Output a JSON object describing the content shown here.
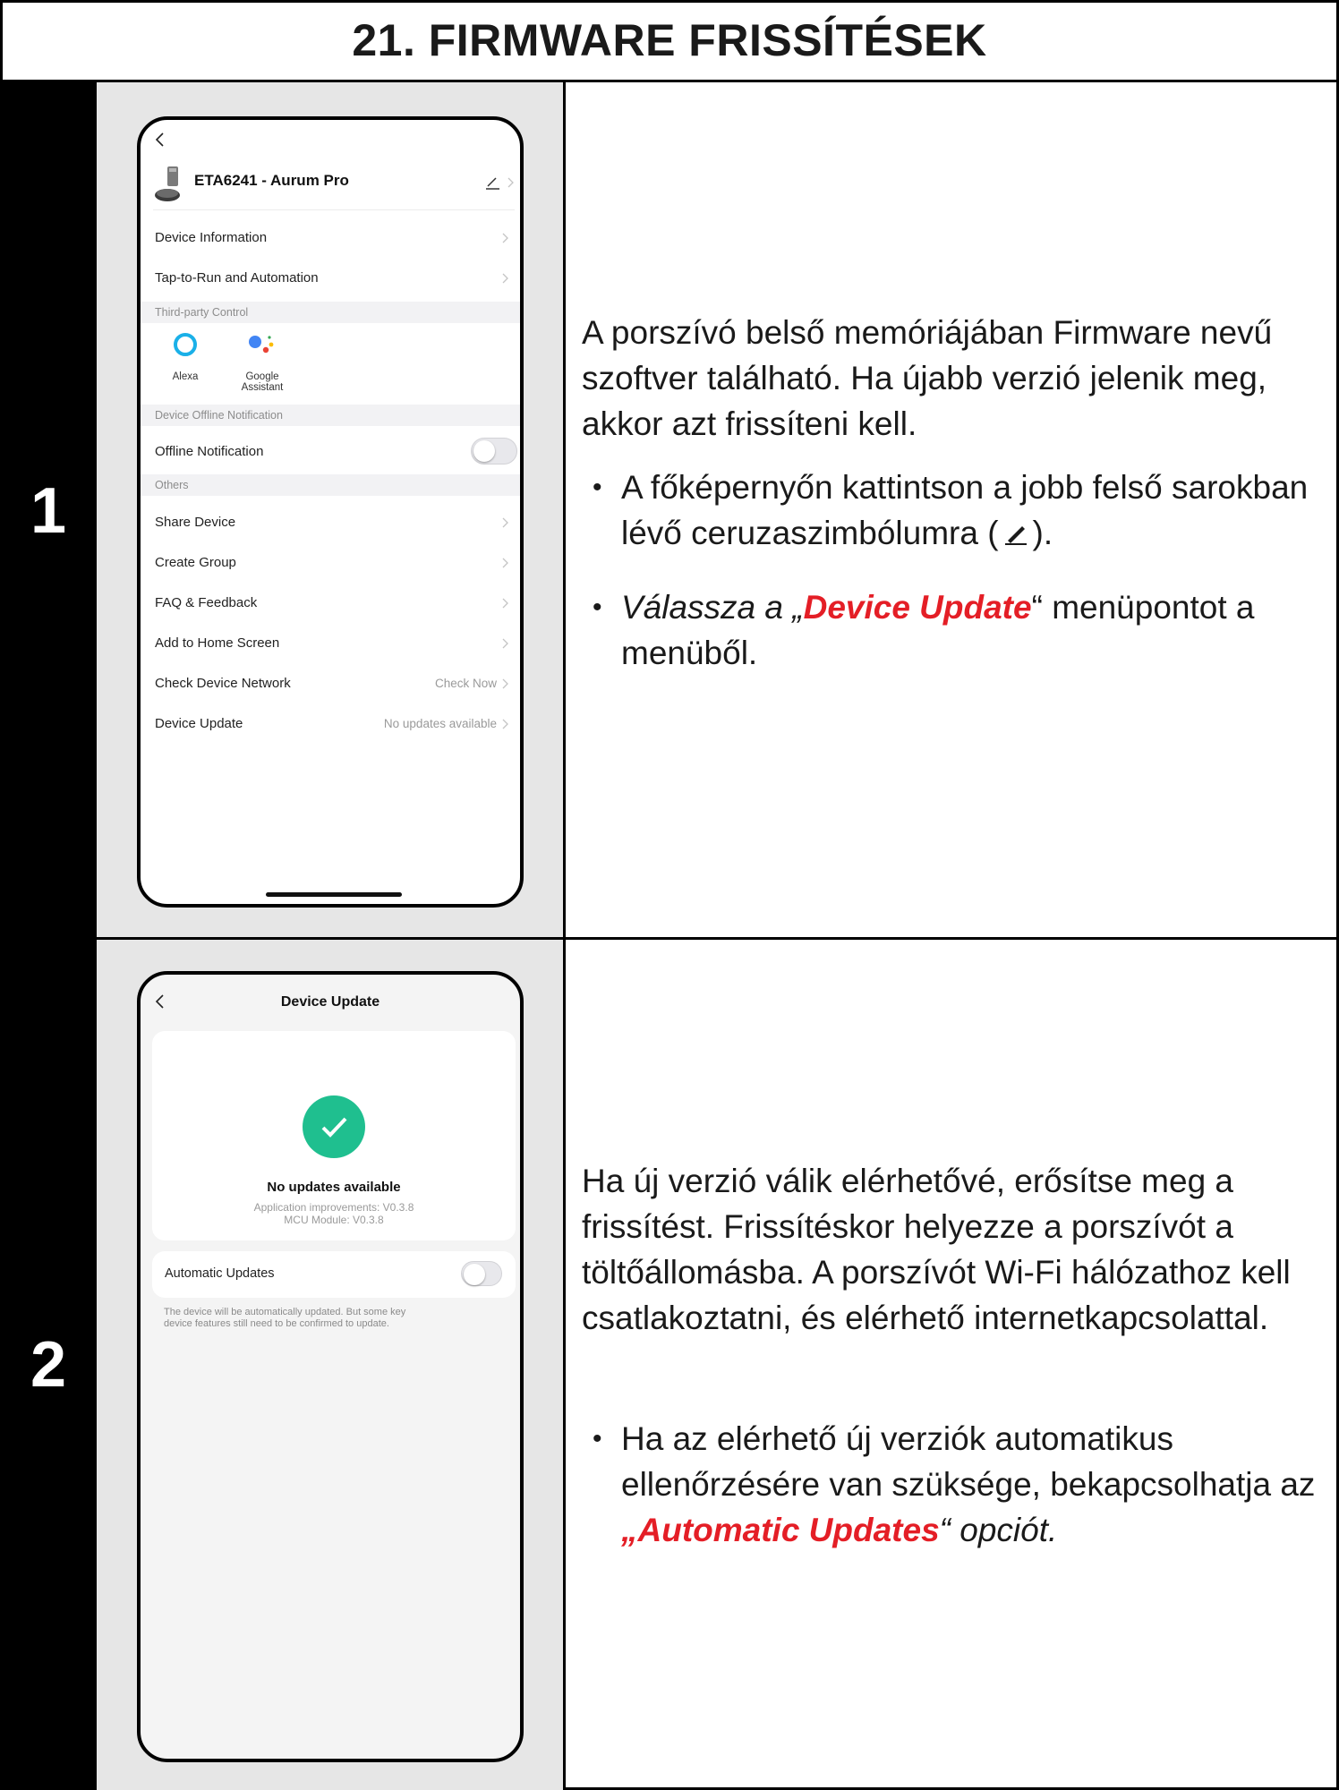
{
  "page_title": "21. FIRMWARE FRISSÍTÉSEK",
  "steps": [
    {
      "number": "1"
    },
    {
      "number": "2"
    }
  ],
  "step1": {
    "intro": "A porszívó belső memóriájában Firmware nevű szoftver található. Ha újabb verzió jelenik meg, akkor azt frissíteni kell.",
    "bullet1_text": "A főképernyőn kattintson a jobb felső sarokban lévő ceruzaszimbólumra (",
    "bullet1_end": ").",
    "bullet2_prefix": "Válassza a „",
    "bullet2_highlight": "Device Update",
    "bullet2_suffix": "“ menüpontot a menüből."
  },
  "step2": {
    "intro": "Ha új verzió válik elérhetővé, erősítse meg a frissítést. Frissítéskor helyezze a porszívót a töltőállomásba. A porszívót Wi-Fi hálózathoz kell csatlakoztatni, és elérhető internetkapcsolattal.",
    "bullet_text": "Ha az elérhető új verziók automatikus ellenőrzésére van szüksége, bekapcsolhatja az ",
    "bullet_open_quote": "„",
    "bullet_highlight": "Automatic Updates",
    "bullet_suffix": "“ opciót."
  },
  "phone1": {
    "device_name": "ETA6241 - Aurum Pro",
    "menu": {
      "device_information": "Device Information",
      "tap_to_run": "Tap-to-Run and Automation",
      "third_party_section": "Third-party Control",
      "alexa": "Alexa",
      "google_line1": "Google",
      "google_line2": "Assistant",
      "offline_section": "Device Offline Notification",
      "offline_notification": "Offline Notification",
      "others_section": "Others",
      "share_device": "Share Device",
      "create_group": "Create Group",
      "faq": "FAQ & Feedback",
      "add_home": "Add to Home Screen",
      "check_network": "Check Device Network",
      "check_now": "Check Now",
      "device_update": "Device Update",
      "no_updates": "No updates available"
    }
  },
  "phone2": {
    "title": "Device Update",
    "status": "No updates available",
    "app_version": "Application improvements: V0.3.8",
    "mcu_version": "MCU Module: V0.3.8",
    "auto_updates": "Automatic Updates",
    "auto_desc_line1": "The device will be automatically updated. But some key",
    "auto_desc_line2": "device features still need to be confirmed to update."
  },
  "colors": {
    "highlight_red": "#e41e26",
    "success_green": "#1fbf8f",
    "alexa_blue": "#1ab0e8"
  }
}
